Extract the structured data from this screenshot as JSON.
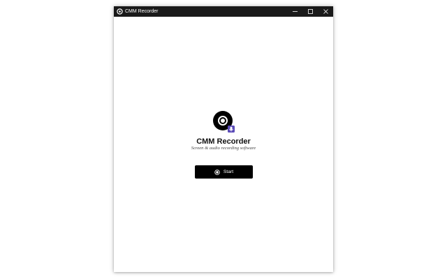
{
  "window": {
    "title": "CMM Recorder",
    "controls": [
      "minimize",
      "maximize",
      "close"
    ]
  },
  "app": {
    "name": "CMM Recorder",
    "tagline": "Screen & audio recording software",
    "logo_icon": "disc-record-icon",
    "badge_icon": "microphone-badge-icon"
  },
  "actions": {
    "start_label": "Start",
    "start_icon": "record-icon"
  },
  "colors": {
    "titlebar": "#1a1a1a",
    "button": "#000000",
    "badge": "#5b4bb7",
    "background": "#ffffff"
  }
}
